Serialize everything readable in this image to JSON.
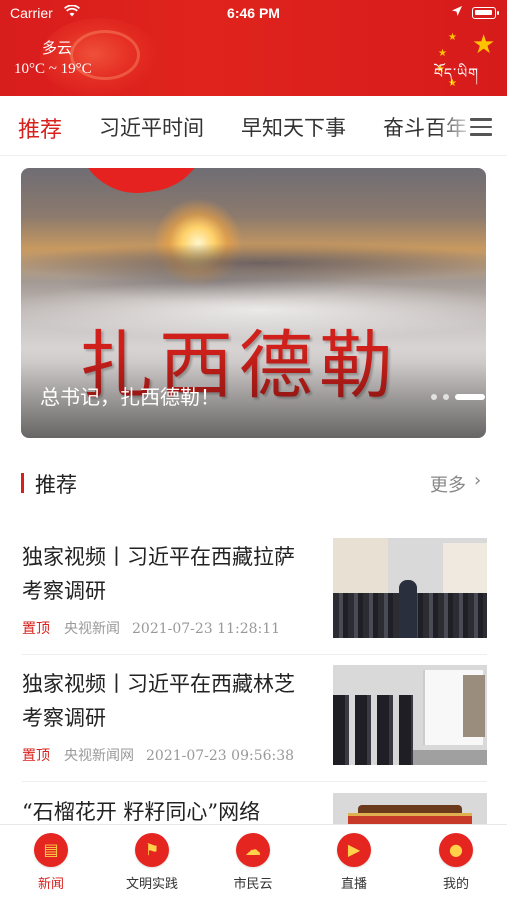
{
  "status_bar": {
    "carrier": "Carrier",
    "time": "6:46 PM"
  },
  "weather": {
    "condition": "多云",
    "temperature": "10°C ~ 19°C"
  },
  "header": {
    "tibetan_text": "བོད་ཡིག"
  },
  "tabs": [
    {
      "label": "推荐",
      "active": true
    },
    {
      "label": "习近平时间",
      "active": false
    },
    {
      "label": "早知天下事",
      "active": false
    },
    {
      "label": "奋斗百年",
      "active": false
    }
  ],
  "banner": {
    "big_title": "扎西德勒",
    "caption": "总书记，扎西德勒！",
    "slide_index": 3,
    "slide_count": 3
  },
  "section": {
    "title": "推荐",
    "more": "更多"
  },
  "news": [
    {
      "title": "独家视频丨习近平在西藏拉萨考察调研",
      "tag": "置顶",
      "source": "央视新闻",
      "time": "2021-07-23 11:28:11"
    },
    {
      "title": "独家视频丨习近平在西藏林芝考察调研",
      "tag": "置顶",
      "source": "央视新闻网",
      "time": "2021-07-23 09:56:38"
    },
    {
      "title": "“石榴花开 籽籽同心”网络",
      "tag": "",
      "source": "",
      "time": ""
    }
  ],
  "bottom_nav": [
    {
      "label": "新闻",
      "icon": "news-icon",
      "active": true
    },
    {
      "label": "文明实践",
      "icon": "flag-icon",
      "active": false
    },
    {
      "label": "市民云",
      "icon": "citizen-cloud-icon",
      "active": false
    },
    {
      "label": "直播",
      "icon": "live-tv-icon",
      "active": false
    },
    {
      "label": "我的",
      "icon": "user-icon",
      "active": false
    }
  ],
  "colors": {
    "brand_red": "#d8201c",
    "star_gold": "#ffc400"
  }
}
